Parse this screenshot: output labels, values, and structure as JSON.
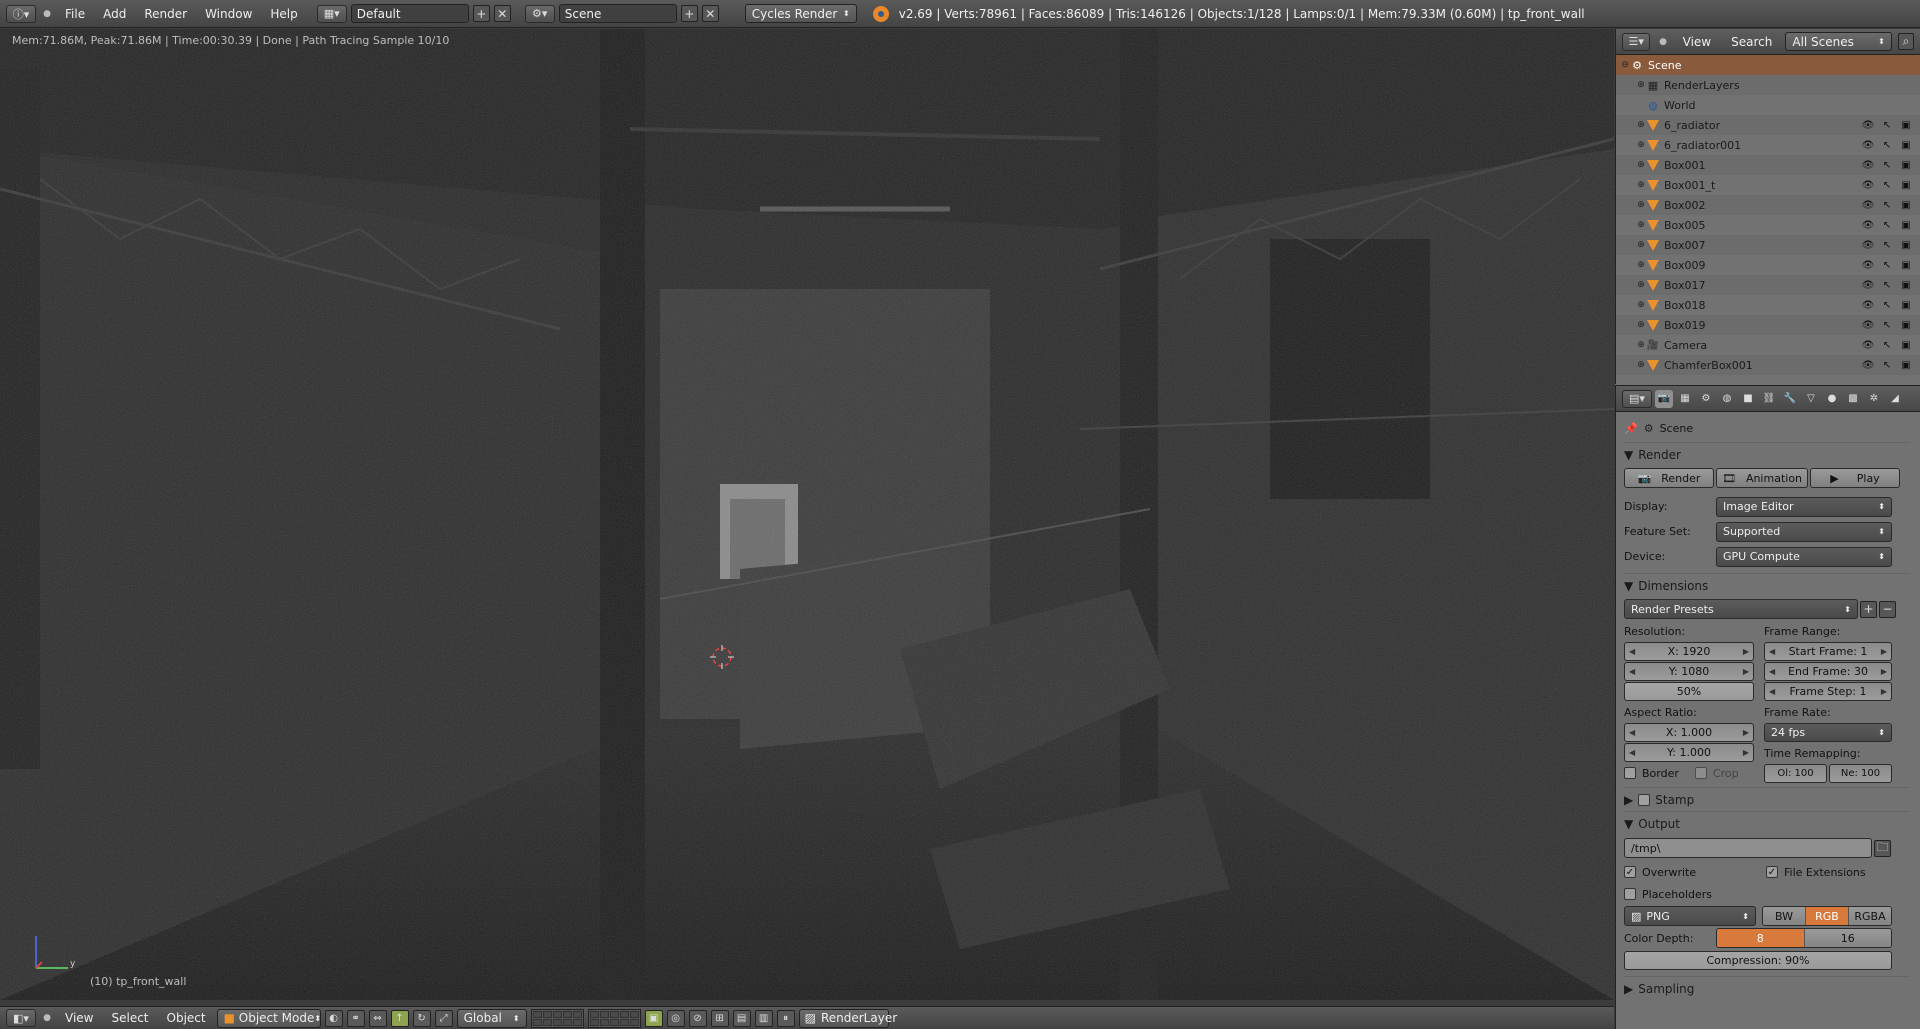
{
  "topbar": {
    "menus": [
      "File",
      "Add",
      "Render",
      "Window",
      "Help"
    ],
    "screen_layout": "Default",
    "scene": "Scene",
    "engine": "Cycles Render",
    "stats": "v2.69 | Verts:78961 | Faces:86089 | Tris:146126 | Objects:1/128 | Lamps:0/1 | Mem:79.33M (0.60M) | tp_front_wall"
  },
  "viewport": {
    "info": "Mem:71.86M, Peak:71.86M | Time:00:30.39 | Done | Path Tracing Sample 10/10",
    "object_label": "(10) tp_front_wall"
  },
  "bottombar": {
    "menus": [
      "View",
      "Select",
      "Object"
    ],
    "mode": "Object Mode",
    "orientation": "Global",
    "render_layer": "RenderLayer"
  },
  "outliner": {
    "menus": [
      "View",
      "Search"
    ],
    "scope": "All Scenes",
    "items": [
      {
        "label": "Scene",
        "type": "scene",
        "depth": 0
      },
      {
        "label": "RenderLayers",
        "type": "renderlayers",
        "depth": 1
      },
      {
        "label": "World",
        "type": "world",
        "depth": 1
      },
      {
        "label": "6_radiator",
        "type": "mesh",
        "depth": 1
      },
      {
        "label": "6_radiator001",
        "type": "mesh",
        "depth": 1
      },
      {
        "label": "Box001",
        "type": "mesh",
        "depth": 1
      },
      {
        "label": "Box001_t",
        "type": "mesh",
        "depth": 1
      },
      {
        "label": "Box002",
        "type": "mesh",
        "depth": 1
      },
      {
        "label": "Box005",
        "type": "mesh",
        "depth": 1
      },
      {
        "label": "Box007",
        "type": "mesh",
        "depth": 1
      },
      {
        "label": "Box009",
        "type": "mesh",
        "depth": 1
      },
      {
        "label": "Box017",
        "type": "mesh",
        "depth": 1
      },
      {
        "label": "Box018",
        "type": "mesh",
        "depth": 1
      },
      {
        "label": "Box019",
        "type": "mesh",
        "depth": 1
      },
      {
        "label": "Camera",
        "type": "camera",
        "depth": 1
      },
      {
        "label": "ChamferBox001",
        "type": "mesh",
        "depth": 1
      }
    ]
  },
  "properties": {
    "context": "Scene",
    "render": {
      "title": "Render",
      "render_btn": "Render",
      "animation_btn": "Animation",
      "play_btn": "Play",
      "display_label": "Display:",
      "display_value": "Image Editor",
      "feature_label": "Feature Set:",
      "feature_value": "Supported",
      "device_label": "Device:",
      "device_value": "GPU Compute"
    },
    "dimensions": {
      "title": "Dimensions",
      "presets": "Render Presets",
      "resolution_label": "Resolution:",
      "res_x": "X: 1920",
      "res_y": "Y: 1080",
      "res_pct": "50%",
      "frame_range_label": "Frame Range:",
      "start": "Start Frame: 1",
      "end": "End Frame: 30",
      "step": "Frame Step: 1",
      "aspect_label": "Aspect Ratio:",
      "asp_x": "X: 1.000",
      "asp_y": "Y: 1.000",
      "frame_rate_label": "Frame Rate:",
      "fps": "24 fps",
      "time_remap_label": "Time Remapping:",
      "old": "Ol: 100",
      "new": "Ne: 100",
      "border": "Border",
      "crop": "Crop"
    },
    "stamp": {
      "title": "Stamp"
    },
    "output": {
      "title": "Output",
      "path": "/tmp\\",
      "overwrite": "Overwrite",
      "file_ext": "File Extensions",
      "placeholders": "Placeholders",
      "format": "PNG",
      "bw": "BW",
      "rgb": "RGB",
      "rgba": "RGBA",
      "depth_label": "Color Depth:",
      "depth_8": "8",
      "depth_16": "16",
      "compression": "Compression: 90%"
    },
    "sampling": {
      "title": "Sampling"
    }
  },
  "colors": {
    "accent": "#d77a3b",
    "selection": "#8a5a3c",
    "mesh_icon": "#e8912d"
  }
}
